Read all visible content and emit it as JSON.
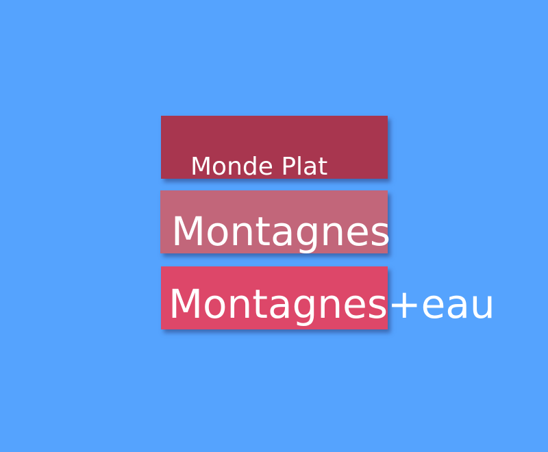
{
  "background_color": "#55a3fe",
  "menu": {
    "items": [
      {
        "label": "Monde Plat",
        "color": "#a8364f"
      },
      {
        "label": "Montagnes",
        "color": "#c2667a"
      },
      {
        "label": "Montagnes+eau",
        "color": "#dd4769"
      }
    ]
  }
}
